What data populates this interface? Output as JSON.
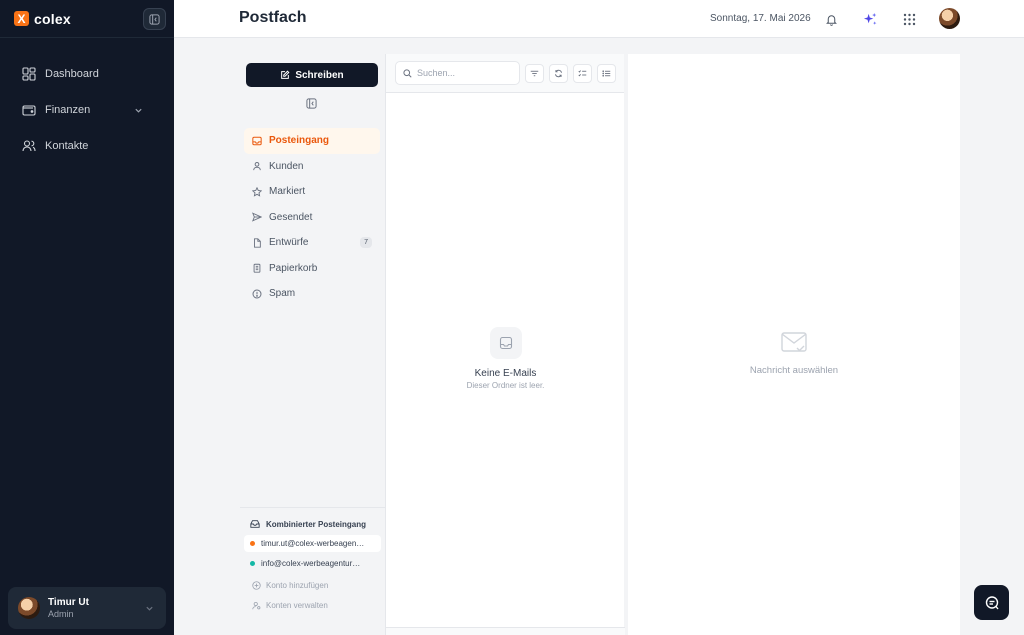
{
  "brand": {
    "name": "colex",
    "logo_letter": "X",
    "accent": "#f97316"
  },
  "sidebar": {
    "items": [
      {
        "label": "Dashboard",
        "icon": "grid-icon"
      },
      {
        "label": "Finanzen",
        "icon": "wallet-icon",
        "has_submenu": true
      },
      {
        "label": "Kontakte",
        "icon": "users-icon"
      }
    ],
    "user": {
      "name": "Timur Ut",
      "role": "Admin"
    }
  },
  "header": {
    "title": "Postfach",
    "date": "Sonntag, 17. Mai 2026",
    "icons": [
      "bell-icon",
      "sparkles-icon",
      "apps-grid-icon"
    ]
  },
  "mail": {
    "compose_label": "Schreiben",
    "folders": [
      {
        "label": "Posteingang",
        "icon": "inbox-icon",
        "active": true
      },
      {
        "label": "Kunden",
        "icon": "user-icon"
      },
      {
        "label": "Markiert",
        "icon": "star-icon"
      },
      {
        "label": "Gesendet",
        "icon": "send-icon"
      },
      {
        "label": "Entwürfe",
        "icon": "file-icon",
        "badge": "7"
      },
      {
        "label": "Papierkorb",
        "icon": "trash-icon"
      },
      {
        "label": "Spam",
        "icon": "alert-icon"
      }
    ],
    "accounts": {
      "heading": "Kombinierter Posteingang",
      "list": [
        {
          "email": "timur.ut@colex-werbeagen…",
          "color": "#f97316",
          "active": true
        },
        {
          "email": "info@colex-werbeagentur…",
          "color": "#14b8a6",
          "active": false
        }
      ],
      "add_label": "Konto hinzufügen",
      "manage_label": "Konten verwalten"
    },
    "search_placeholder": "Suchen...",
    "empty_title": "Keine E-Mails",
    "empty_subtitle": "Dieser Ordner ist leer.",
    "reader_placeholder": "Nachricht auswählen"
  }
}
